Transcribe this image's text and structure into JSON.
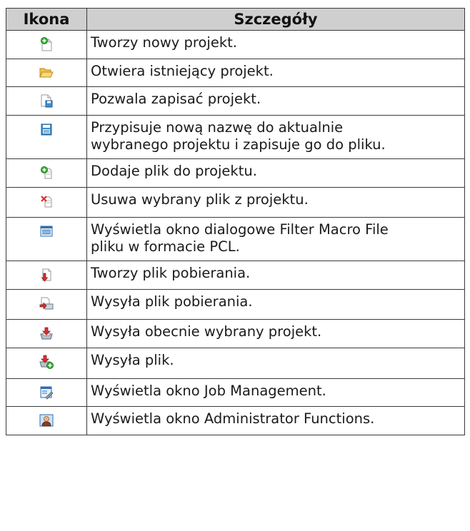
{
  "table": {
    "headers": {
      "icon": "Ikona",
      "details": "Szczegóły"
    },
    "rows": [
      {
        "icon": "new-project-icon",
        "lines": [
          "Tworzy nowy projekt."
        ]
      },
      {
        "icon": "open-folder-icon",
        "lines": [
          "Otwiera istniejący projekt."
        ]
      },
      {
        "icon": "save-project-icon",
        "lines": [
          "Pozwala zapisać projekt."
        ]
      },
      {
        "icon": "save-as-icon",
        "lines": [
          "Przypisuje nową nazwę do aktualnie",
          "wybranego projektu i zapisuje go do pliku."
        ]
      },
      {
        "icon": "add-file-icon",
        "lines": [
          "Dodaje plik do projektu."
        ]
      },
      {
        "icon": "remove-file-icon",
        "lines": [
          "Usuwa wybrany plik z projektu."
        ]
      },
      {
        "icon": "filter-macro-icon",
        "lines": [
          "Wyświetla okno dialogowe Filter Macro File",
          "pliku w formacie PCL."
        ]
      },
      {
        "icon": "create-download-icon",
        "lines": [
          "Tworzy plik pobierania."
        ]
      },
      {
        "icon": "send-download-icon",
        "lines": [
          "Wysyła plik pobierania."
        ]
      },
      {
        "icon": "send-project-icon",
        "lines": [
          "Wysyła obecnie wybrany projekt."
        ]
      },
      {
        "icon": "send-file-icon",
        "lines": [
          "Wysyła plik."
        ]
      },
      {
        "icon": "job-management-icon",
        "lines": [
          "Wyświetla okno Job Management."
        ]
      },
      {
        "icon": "administrator-icon",
        "lines": [
          "Wyświetla okno Administrator Functions."
        ]
      }
    ]
  },
  "colors": {
    "header_bg": "#cfcfcf",
    "border": "#3a3a3a"
  }
}
